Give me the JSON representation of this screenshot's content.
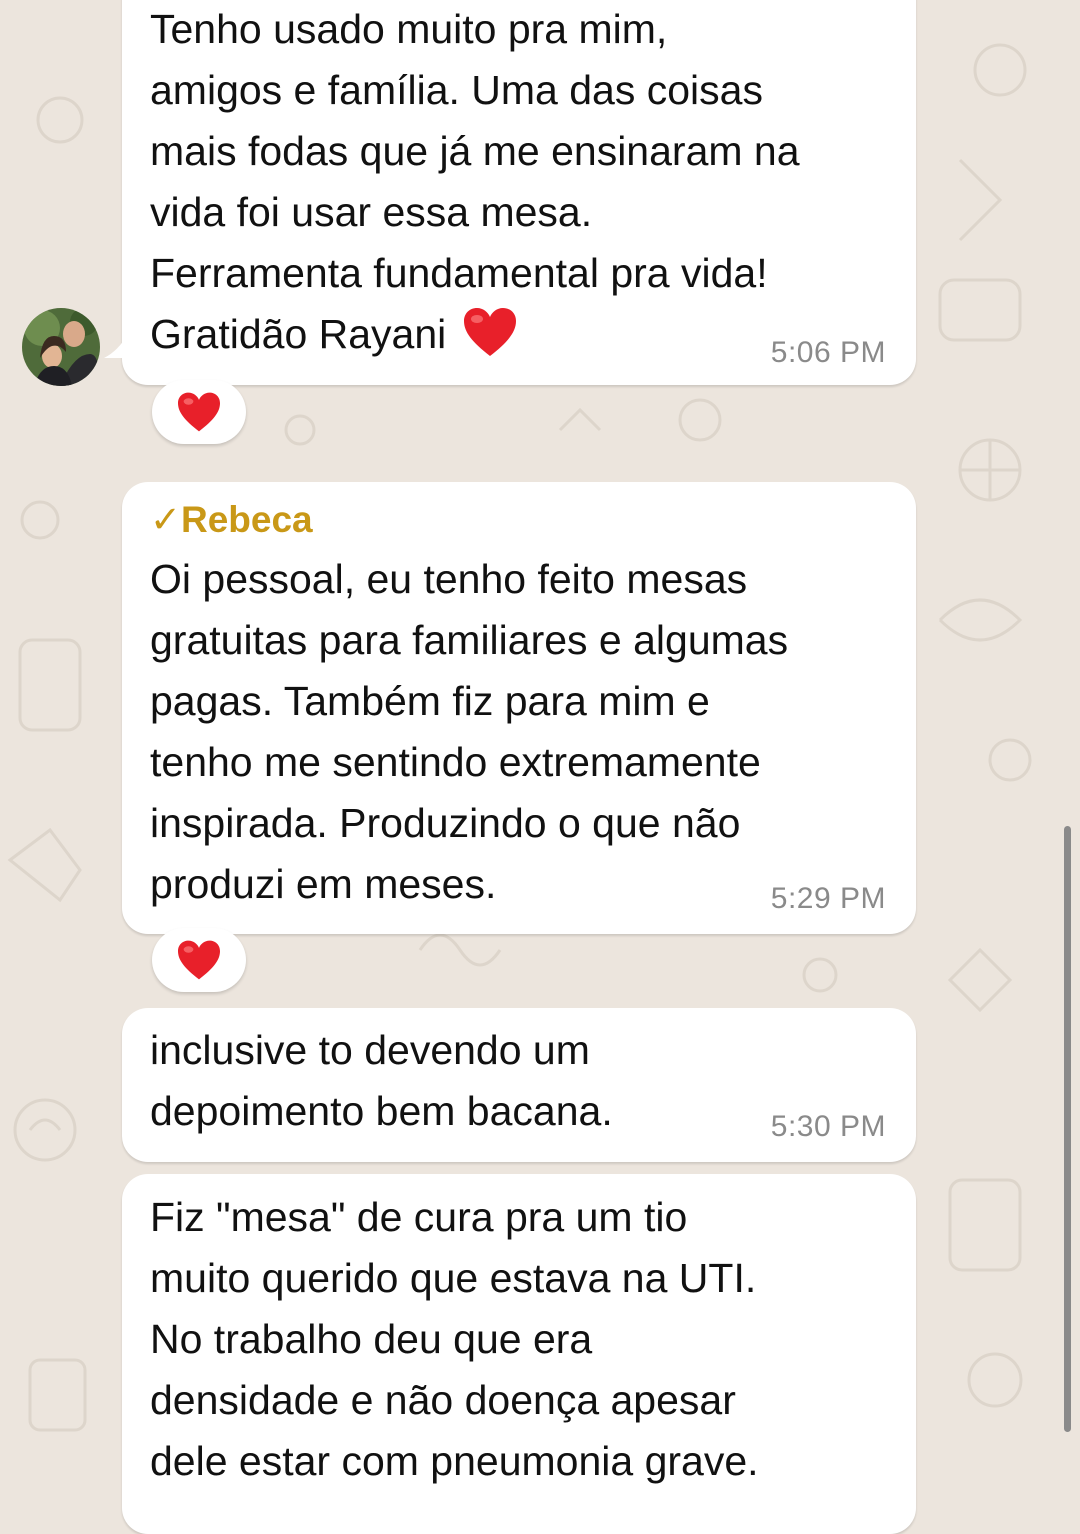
{
  "messages": [
    {
      "text": "Tenho usado muito pra mim,\namigos e família. Uma das coisas\nmais fodas que já me ensinaram na\nvida foi usar essa mesa.\nFerramenta fundamental pra vida!\nGratidão Rayani",
      "emoji": "heart",
      "time": "5:06 PM",
      "reaction": "heart"
    },
    {
      "sender": "✓Rebeca",
      "text": "Oi pessoal, eu tenho feito mesas\ngratuitas para familiares e algumas\npagas. Também fiz para mim e\ntenho me sentindo extremamente\ninspirada. Produzindo o que não\nproduzi em meses.",
      "time": "5:29 PM",
      "reaction": "heart"
    },
    {
      "text": "inclusive to devendo um\ndepoimento bem bacana.",
      "time": "5:30 PM"
    },
    {
      "text": "Fiz \"mesa\" de cura pra um tio\nmuito querido que estava na UTI.\nNo trabalho deu que era\ndensidade e não doença apesar\ndele estar com pneumonia grave."
    }
  ],
  "colors": {
    "background": "#ece5dd",
    "bubble": "#ffffff",
    "sender_name": "#c99817",
    "timestamp": "#8a8a8a",
    "heart": "#e8202a"
  },
  "icons": [
    "avatar",
    "red-heart-icon",
    "check-icon"
  ]
}
